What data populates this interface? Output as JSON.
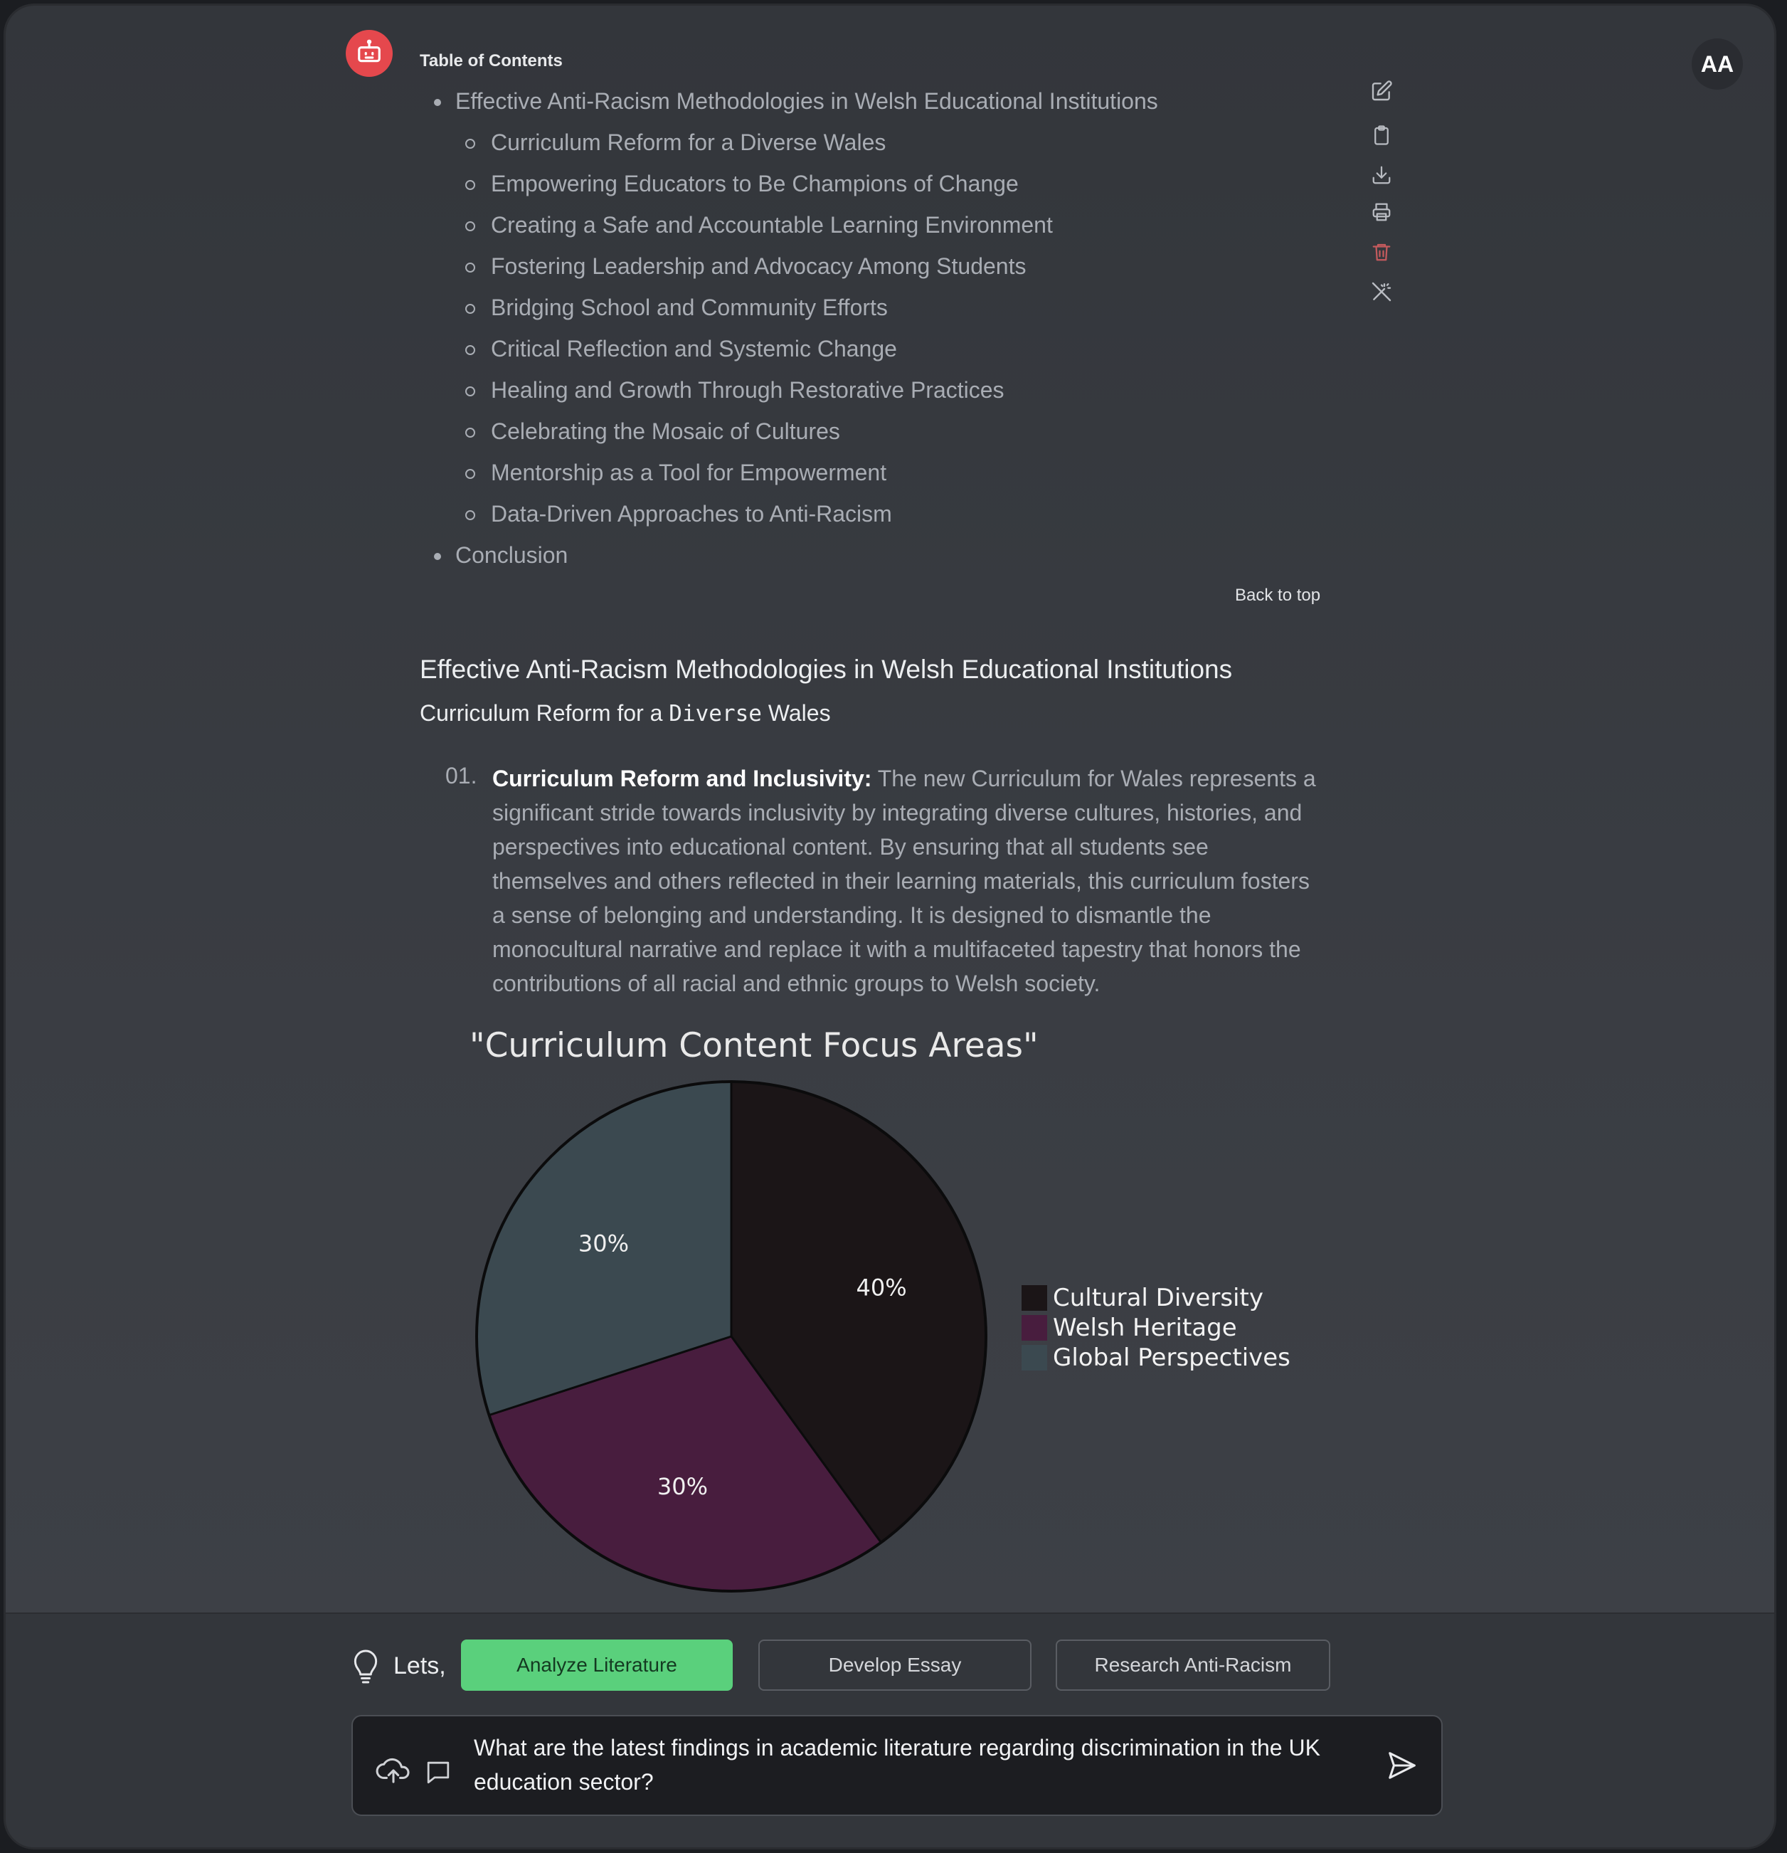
{
  "header": {
    "user_initials": "AA",
    "toc_title": "Table of Contents"
  },
  "toc": {
    "items": [
      {
        "level": 1,
        "label": "Effective Anti-Racism Methodologies in Welsh Educational Institutions"
      },
      {
        "level": 2,
        "label": "Curriculum Reform for a Diverse Wales"
      },
      {
        "level": 2,
        "label": "Empowering Educators to Be Champions of Change"
      },
      {
        "level": 2,
        "label": "Creating a Safe and Accountable Learning Environment"
      },
      {
        "level": 2,
        "label": "Fostering Leadership and Advocacy Among Students"
      },
      {
        "level": 2,
        "label": "Bridging School and Community Efforts"
      },
      {
        "level": 2,
        "label": "Critical Reflection and Systemic Change"
      },
      {
        "level": 2,
        "label": "Healing and Growth Through Restorative Practices"
      },
      {
        "level": 2,
        "label": "Celebrating the Mosaic of Cultures"
      },
      {
        "level": 2,
        "label": "Mentorship as a Tool for Empowerment"
      },
      {
        "level": 2,
        "label": "Data-Driven Approaches to Anti-Racism"
      },
      {
        "level": 1,
        "label": "Conclusion"
      }
    ],
    "back_to_top": "Back to top"
  },
  "toolbar": {
    "icons": [
      "edit-icon",
      "clipboard-icon",
      "download-icon",
      "print-icon",
      "trash-icon",
      "magic-wand-icon"
    ]
  },
  "content": {
    "heading": "Effective Anti-Racism Methodologies in Welsh Educational Institutions",
    "subheading_before": "Curriculum Reform for a ",
    "subheading_code": "Diverse",
    "subheading_after": " Wales",
    "list_number": "01.",
    "item_title": "Curriculum Reform and Inclusivity:",
    "item_body": " The new Curriculum for Wales represents a significant stride towards inclusivity by integrating diverse cultures, histories, and perspectives into educational content. By ensuring that all students see themselves and others reflected in their learning materials, this curriculum fosters a sense of belonging and understanding. It is designed to dismantle the monocultural narrative and replace it with a multifaceted tapestry that honors the contributions of all racial and ethnic groups to Welsh society."
  },
  "chart_data": {
    "type": "pie",
    "title": "\"Curriculum Content Focus Areas\"",
    "categories": [
      "Cultural Diversity",
      "Welsh Heritage",
      "Global Perspectives"
    ],
    "values": [
      40,
      30,
      30
    ],
    "labels": [
      "40%",
      "30%",
      "30%"
    ],
    "colors": [
      "#1b1517",
      "#481d3e",
      "#3b4950"
    ],
    "legend": "right",
    "start": "top, clockwise"
  },
  "suggestions": {
    "prefix": "Lets,",
    "chips": [
      {
        "label": "Analyze Literature",
        "active": true
      },
      {
        "label": "Develop Essay",
        "active": false
      },
      {
        "label": "Research Anti-Racism",
        "active": false
      }
    ]
  },
  "composer": {
    "value": "What are the latest findings in academic literature regarding discrimination in the UK education sector?"
  },
  "colors": {
    "accent_green": "#5ad07c",
    "bot_red": "#e5484d",
    "trash_red": "#c45a5d"
  }
}
